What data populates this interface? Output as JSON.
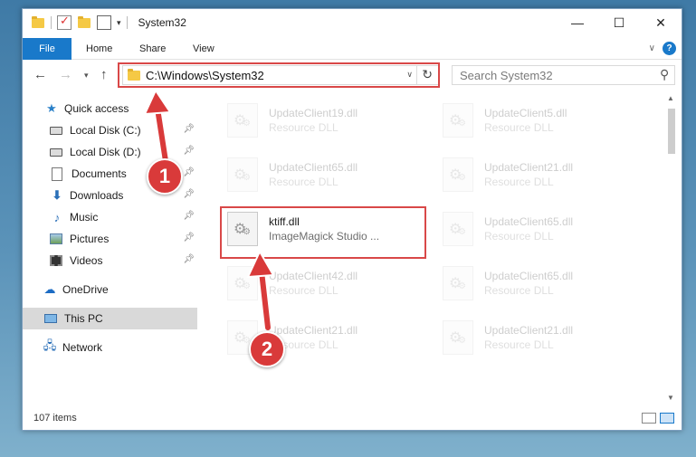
{
  "window": {
    "title": "System32"
  },
  "controls": {
    "minimize": "—",
    "maximize": "☐",
    "close": "✕"
  },
  "ribbon": {
    "tabs": [
      "File",
      "Home",
      "Share",
      "View"
    ]
  },
  "navigation": {
    "address": "C:\\Windows\\System32",
    "search_placeholder": "Search System32"
  },
  "sidebar": {
    "items": [
      {
        "label": "Quick access",
        "icon": "star-icon",
        "pinned": false
      },
      {
        "label": "Local Disk (C:)",
        "icon": "drive-icon",
        "pinned": true
      },
      {
        "label": "Local Disk (D:)",
        "icon": "drive-icon",
        "pinned": true
      },
      {
        "label": "Documents",
        "icon": "documents-icon",
        "pinned": true
      },
      {
        "label": "Downloads",
        "icon": "downloads-icon",
        "pinned": true
      },
      {
        "label": "Music",
        "icon": "music-icon",
        "pinned": true
      },
      {
        "label": "Pictures",
        "icon": "pictures-icon",
        "pinned": true
      },
      {
        "label": "Videos",
        "icon": "videos-icon",
        "pinned": true
      },
      {
        "label": "OneDrive",
        "icon": "onedrive-icon",
        "pinned": false
      },
      {
        "label": "This PC",
        "icon": "this-pc-icon",
        "pinned": false,
        "selected": true
      },
      {
        "label": "Network",
        "icon": "network-icon",
        "pinned": false
      }
    ]
  },
  "files": [
    {
      "name": "UpdateClient19.dll",
      "description": "Resource DLL",
      "faded": true
    },
    {
      "name": "UpdateClient5.dll",
      "description": "Resource DLL",
      "faded": true
    },
    {
      "name": "UpdateClient65.dll",
      "description": "Resource DLL",
      "faded": true
    },
    {
      "name": "UpdateClient21.dll",
      "description": "Resource DLL",
      "faded": true
    },
    {
      "name": "ktiff.dll",
      "description": "ImageMagick Studio ...",
      "faded": false
    },
    {
      "name": "UpdateClient65.dll",
      "description": "Resource DLL",
      "faded": true
    },
    {
      "name": "UpdateClient42.dll",
      "description": "Resource DLL",
      "faded": true
    },
    {
      "name": "UpdateClient65.dll",
      "description": "Resource DLL",
      "faded": true
    },
    {
      "name": "UpdateClient21.dll",
      "description": "Resource DLL",
      "faded": true
    },
    {
      "name": "UpdateClient21.dll",
      "description": "Resource DLL",
      "faded": true
    }
  ],
  "status": {
    "item_count": "107 items"
  },
  "annotations": {
    "step1": "1",
    "step2": "2",
    "color": "#d93a3a"
  },
  "colors": {
    "accent": "#1979ca",
    "highlight": "#d94848"
  }
}
